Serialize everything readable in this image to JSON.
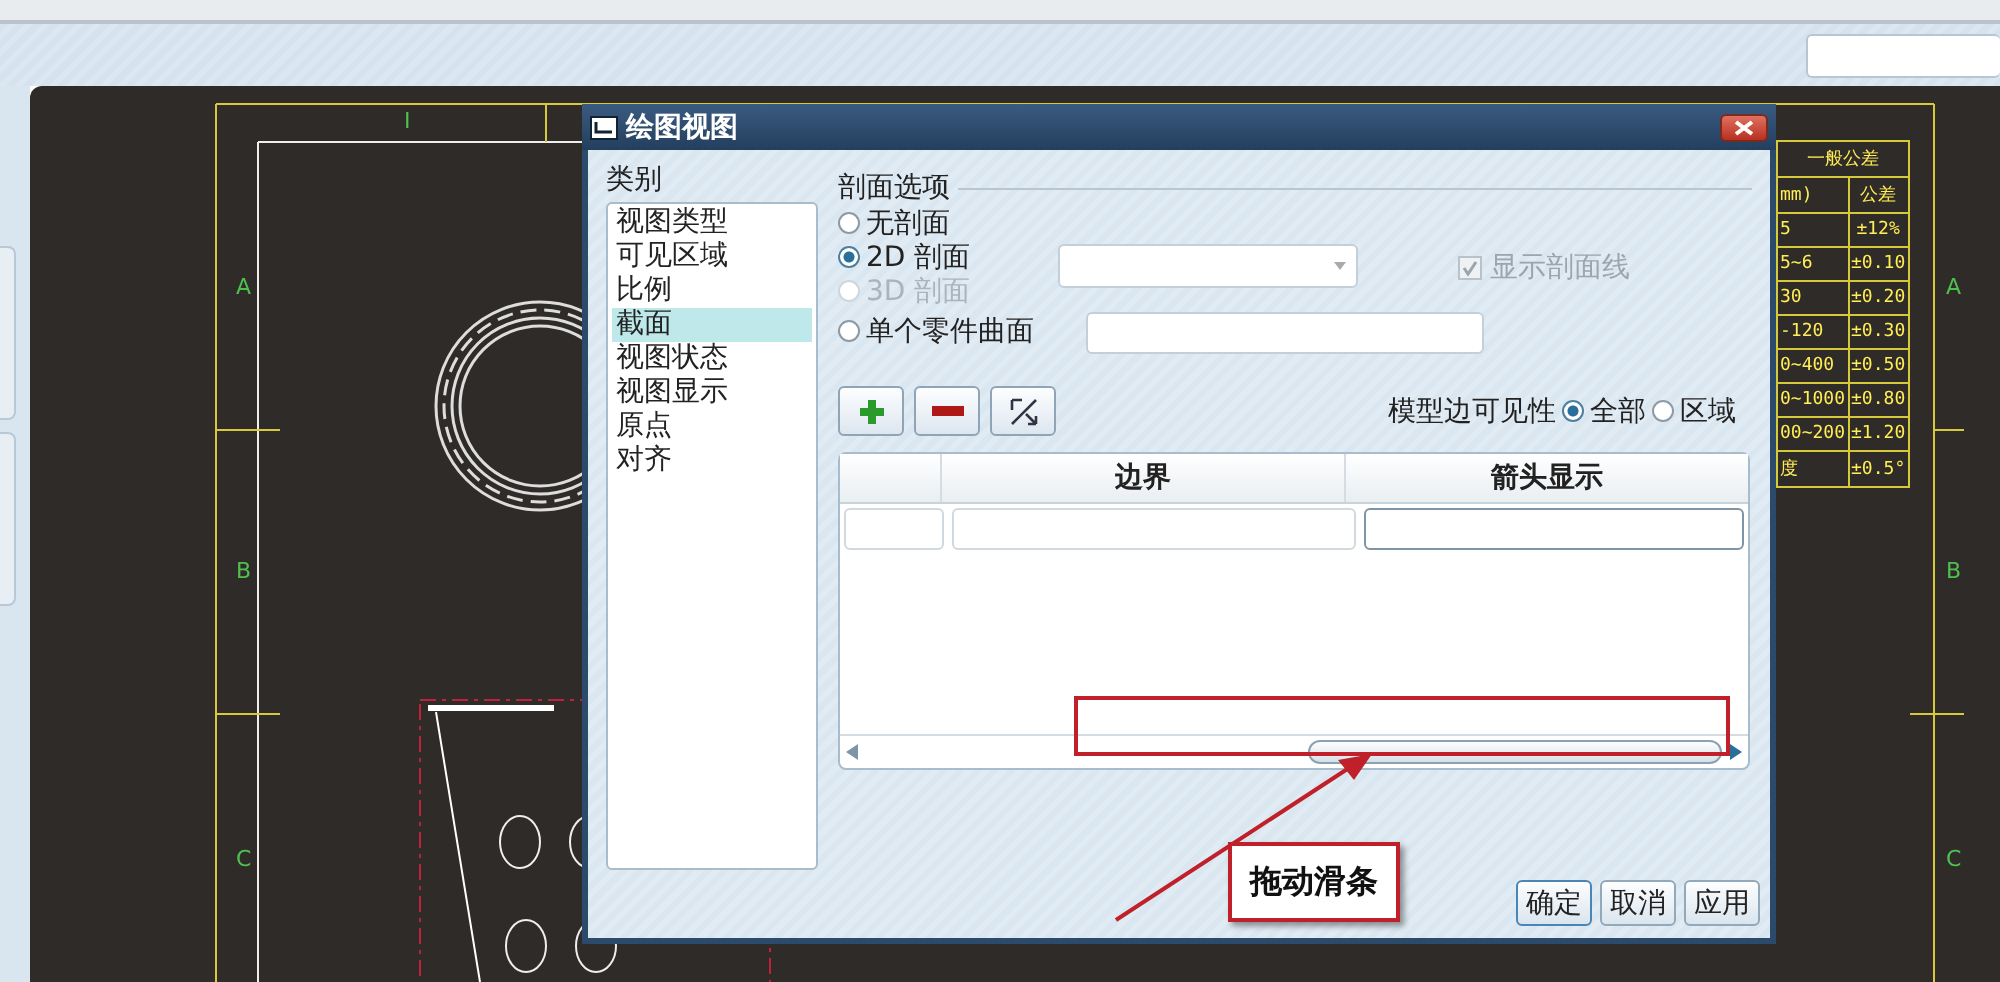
{
  "drawing": {
    "top_marks": [
      "I"
    ],
    "left_zones": [
      "A",
      "B",
      "C"
    ],
    "right_zones": [
      "A",
      "B",
      "C"
    ]
  },
  "tolerance_table": {
    "title": "一般公差",
    "header": [
      "mm)",
      "公差"
    ],
    "rows": [
      [
        "5",
        "±12%"
      ],
      [
        "5~6",
        "±0.10"
      ],
      [
        "30",
        "±0.20"
      ],
      [
        "-120",
        "±0.30"
      ],
      [
        "0~400",
        "±0.50"
      ],
      [
        "0~1000",
        "±0.80"
      ],
      [
        "00~200",
        "±1.20"
      ],
      [
        "度",
        "±0.5°"
      ]
    ]
  },
  "dialog": {
    "title": "绘图视图",
    "category_label": "类别",
    "categories": [
      {
        "label": "视图类型",
        "selected": false
      },
      {
        "label": "可见区域",
        "selected": false
      },
      {
        "label": "比例",
        "selected": false
      },
      {
        "label": "截面",
        "selected": true
      },
      {
        "label": "视图状态",
        "selected": false
      },
      {
        "label": "视图显示",
        "selected": false
      },
      {
        "label": "原点",
        "selected": false
      },
      {
        "label": "对齐",
        "selected": false
      }
    ],
    "section_options": {
      "label": "剖面选项",
      "options": [
        {
          "label": "无剖面",
          "selected": false,
          "disabled": false
        },
        {
          "label": "2D 剖面",
          "selected": true,
          "disabled": false
        },
        {
          "label": "3D 剖面",
          "selected": false,
          "disabled": true
        },
        {
          "label": "单个零件曲面",
          "selected": false,
          "disabled": false
        }
      ]
    },
    "show_hatching": {
      "label": "显示剖面线",
      "checked": true,
      "disabled": true
    },
    "tool_buttons": [
      {
        "kind": "add"
      },
      {
        "kind": "remove"
      },
      {
        "kind": "flip"
      }
    ],
    "edge_visibility": {
      "label": "模型边可见性",
      "options": [
        {
          "label": "全部",
          "selected": true
        },
        {
          "label": "区域",
          "selected": false
        }
      ]
    },
    "table": {
      "columns": [
        {
          "label": "边界"
        },
        {
          "label": "箭头显示"
        }
      ]
    },
    "buttons": [
      "确定",
      "取消",
      "应用"
    ]
  },
  "annotation": {
    "text": "拖动滑条"
  }
}
